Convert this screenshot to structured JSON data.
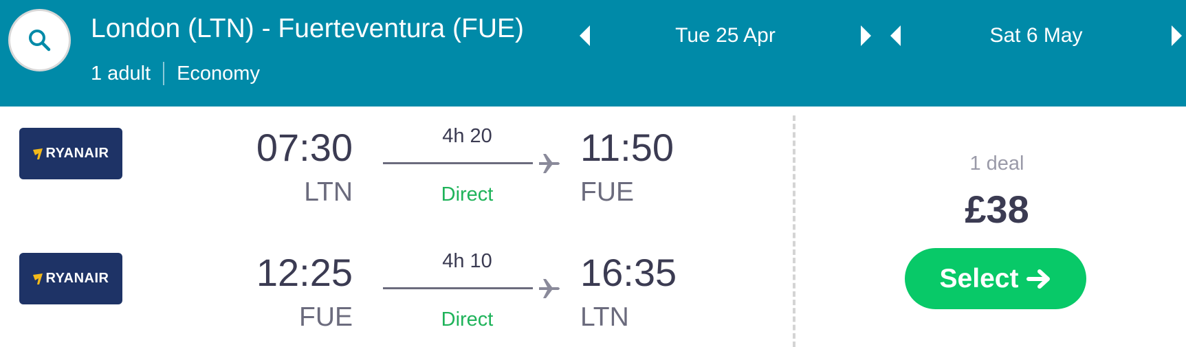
{
  "header": {
    "route": "London (LTN) - Fuerteventura (FUE)",
    "passengers": "1 adult",
    "cabin": "Economy",
    "outbound_date": "Tue 25 Apr",
    "return_date": "Sat 6 May"
  },
  "legs": [
    {
      "airline": "RYANAIR",
      "dep_time": "07:30",
      "dep_code": "LTN",
      "duration": "4h 20",
      "stops": "Direct",
      "arr_time": "11:50",
      "arr_code": "FUE"
    },
    {
      "airline": "RYANAIR",
      "dep_time": "12:25",
      "dep_code": "FUE",
      "duration": "4h 10",
      "stops": "Direct",
      "arr_time": "16:35",
      "arr_code": "LTN"
    }
  ],
  "offer": {
    "deals": "1 deal",
    "price": "£38",
    "select_label": "Select"
  },
  "colors": {
    "header_bg": "#008aa8",
    "airline_bg": "#1e3366",
    "direct_green": "#1fb35a",
    "select_green": "#08c968"
  },
  "icons": [
    "search-icon",
    "chevron-left-icon",
    "chevron-right-icon",
    "plane-icon",
    "arrow-right-icon",
    "ryanair-harp-icon"
  ]
}
